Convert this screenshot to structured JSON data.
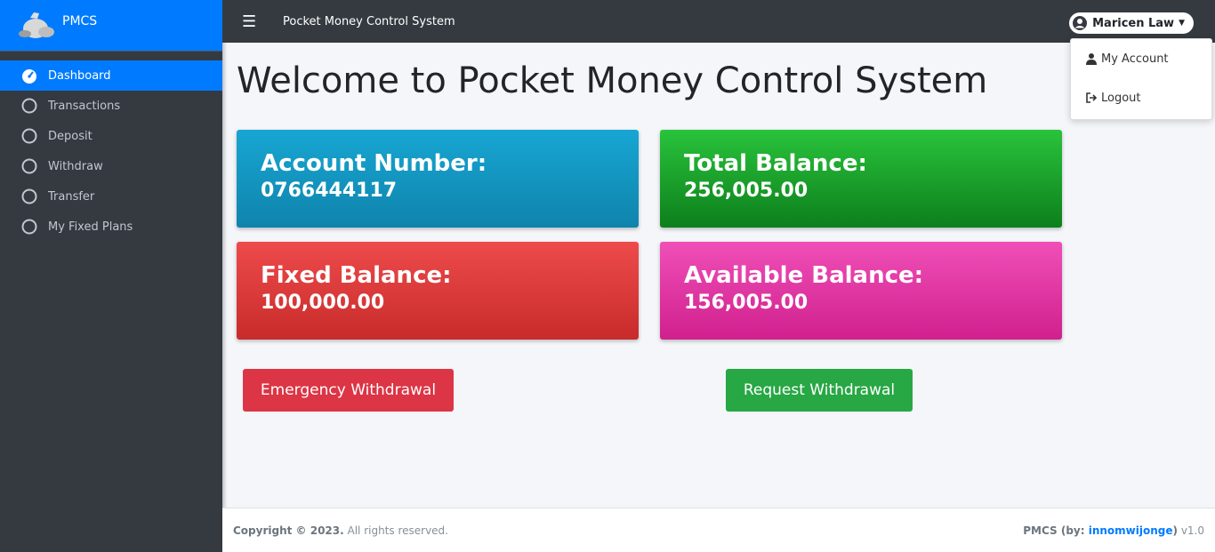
{
  "brand": {
    "name": "PMCS",
    "logo_icon": "money-bag-icon"
  },
  "sidebar": {
    "items": [
      {
        "label": "Dashboard",
        "icon": "dashboard-icon",
        "active": true
      },
      {
        "label": "Transactions",
        "icon": "circle-icon"
      },
      {
        "label": "Deposit",
        "icon": "circle-icon"
      },
      {
        "label": "Withdraw",
        "icon": "circle-icon"
      },
      {
        "label": "Transfer",
        "icon": "circle-icon"
      },
      {
        "label": "My Fixed Plans",
        "icon": "circle-icon"
      }
    ]
  },
  "navbar": {
    "title": "Pocket Money Control System",
    "menu_icon": "hamburger-icon"
  },
  "user": {
    "name": "Maricen Law",
    "menu": [
      {
        "label": "My Account",
        "icon": "user-icon"
      },
      {
        "label": "Logout",
        "icon": "logout-icon"
      }
    ]
  },
  "main": {
    "title": "Welcome to Pocket Money Control System",
    "cards": [
      {
        "label": "Account Number:",
        "value": "0766444117",
        "color": "#17a2b8"
      },
      {
        "label": "Total Balance:",
        "value": "256,005.00",
        "color": "#28a745"
      },
      {
        "label": "Fixed Balance:",
        "value": "100,000.00",
        "color": "#dc3545"
      },
      {
        "label": "Available Balance:",
        "value": "156,005.00",
        "color": "#e83e8c"
      }
    ],
    "buttons": {
      "emergency": "Emergency Withdrawal",
      "request": "Request Withdrawal"
    }
  },
  "footer": {
    "copyright": "Copyright © 2023.",
    "rights": " All rights reserved.",
    "app": "PMCS (by: ",
    "author": "innomwijonge",
    "version_tail": " ) v1.0"
  },
  "colors": {
    "accent": "#007bff",
    "sidebar": "#343a40",
    "danger": "#dc3545",
    "success": "#28a745"
  }
}
